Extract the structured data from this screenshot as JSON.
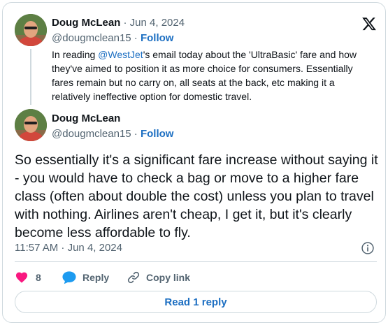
{
  "parent_tweet": {
    "author_name": "Doug McLean",
    "date": " · Jun 4, 2024",
    "handle": "@dougmclean15",
    "follow_label": "Follow",
    "text_before": "In reading ",
    "mention": "@WestJet",
    "text_after": "'s email today about the 'UltraBasic' fare and how they've aimed to position it as more choice for consumers. Essentially fares remain but no carry on, all seats at the back, etc making it a relatively ineffective option for domestic travel."
  },
  "main_tweet": {
    "author_name": "Doug McLean",
    "handle": "@dougmclean15",
    "follow_label": "Follow",
    "text": "So essentially it's a significant fare increase without saying it - you would have to check a bag or move to a higher fare class (often about double the cost) unless you plan to travel with nothing. Airlines aren't cheap, I get it, but it's clearly become less affordable to fly.",
    "timestamp": "11:57 AM · Jun 4, 2024"
  },
  "actions": {
    "like_count": "8",
    "reply_label": "Reply",
    "copy_link_label": "Copy link"
  },
  "read_reply_label": "Read 1 reply",
  "icons": {
    "logo": "x-logo-icon",
    "like": "heart-icon",
    "reply": "speech-bubble-icon",
    "copy": "link-icon",
    "info": "info-icon"
  },
  "colors": {
    "link_blue": "#1d6fc2",
    "like_red": "#f91880",
    "muted_gray": "#536471",
    "border": "#cfd9de"
  }
}
